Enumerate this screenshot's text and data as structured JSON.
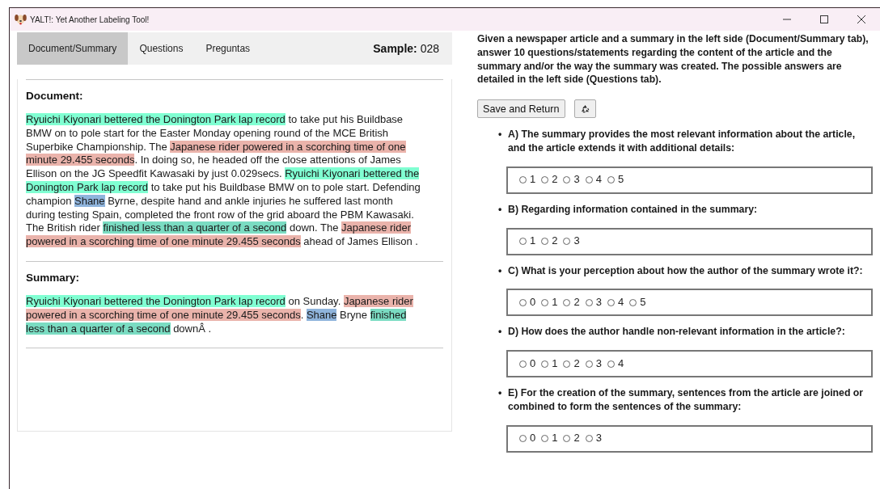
{
  "window": {
    "title": "YALT!: Yet Another Labeling Tool!"
  },
  "tabs": [
    {
      "label": "Document/Summary",
      "selected": true
    },
    {
      "label": "Questions",
      "selected": false
    },
    {
      "label": "Preguntas",
      "selected": false
    }
  ],
  "sample": {
    "label": "Sample:",
    "value": "028"
  },
  "document": {
    "heading": "Document:",
    "segments": [
      {
        "text": "Ryuichi Kiyonari bettered the Donington Park lap record",
        "color": "#80ffd2"
      },
      {
        "text": " to take put his Buildbase BMW on to pole start for the Easter Monday opening round of the MCE British Superbike Championship. The "
      },
      {
        "text": "Japanese rider powered in a scorching time of one minute 29.455 seconds",
        "color": "#eab3ab"
      },
      {
        "text": ". In doing so, he headed off the close attentions of James Ellison on the JG Speedfit Kawasaki by just 0.029secs. "
      },
      {
        "text": "Ryuichi Kiyonari bettered the Donington Park lap record",
        "color": "#80ffd2"
      },
      {
        "text": " to take put his Buildbase BMW on to pole start. Defending champion "
      },
      {
        "text": "Shane",
        "color": "#8fb4dc"
      },
      {
        "text": " Byrne, despite hand and ankle injuries he suffered last month during testing Spain, completed the front row of the grid aboard the PBM Kawasaki. The British rider "
      },
      {
        "text": "finished less than a quarter of a second",
        "color": "#7adcc2"
      },
      {
        "text": " down. The "
      },
      {
        "text": "Japanese rider powered in a scorching time of one minute 29.455 seconds",
        "color": "#eab3ab"
      },
      {
        "text": " ahead of James Ellison ."
      }
    ]
  },
  "summary": {
    "heading": "Summary:",
    "segments": [
      {
        "text": "Ryuichi Kiyonari bettered the Donington Park lap record",
        "color": "#80ffd2"
      },
      {
        "text": " on Sunday. "
      },
      {
        "text": "Japanese rider powered in a scorching time of one minute 29.455 seconds",
        "color": "#eab3ab"
      },
      {
        "text": ". "
      },
      {
        "text": "Shane",
        "color": "#8fb4dc"
      },
      {
        "text": " Bryne "
      },
      {
        "text": "finished less than a quarter of a second",
        "color": "#7adcc2"
      },
      {
        "text": " downÂ ."
      }
    ]
  },
  "instructions": "Given a newspaper article and a summary in the left side (Document/Summary tab), answer 10 questions/statements regarding the content of the article and the summary and/or the way the summary was created. The possible answers are detailed in the left side (Questions tab).",
  "buttons": {
    "save": "Save and Return"
  },
  "questions": [
    {
      "bullet": "•",
      "text": "A) The summary provides the most relevant information about the article, and the article extends it with additional details:",
      "options": [
        {
          "label": "1",
          "selected": false
        },
        {
          "label": "2",
          "selected": false
        },
        {
          "label": "3",
          "selected": false
        },
        {
          "label": "4",
          "selected": false
        },
        {
          "label": "5",
          "selected": false
        }
      ]
    },
    {
      "bullet": "•",
      "text": "B) Regarding information contained in the summary:",
      "options": [
        {
          "label": "1",
          "selected": false
        },
        {
          "label": "2",
          "selected": false
        },
        {
          "label": "3",
          "selected": false
        }
      ]
    },
    {
      "bullet": "•",
      "text": "C) What is your perception about how the author of the summary wrote it?:",
      "options": [
        {
          "label": "0",
          "selected": false
        },
        {
          "label": "1",
          "selected": false
        },
        {
          "label": "2",
          "selected": false
        },
        {
          "label": "3",
          "selected": false
        },
        {
          "label": "4",
          "selected": false
        },
        {
          "label": "5",
          "selected": false
        }
      ]
    },
    {
      "bullet": "•",
      "text": "D) How does the author handle non-relevant information in the article?:",
      "options": [
        {
          "label": "0",
          "selected": false
        },
        {
          "label": "1",
          "selected": false
        },
        {
          "label": "2",
          "selected": false
        },
        {
          "label": "3",
          "selected": false
        },
        {
          "label": "4",
          "selected": false
        }
      ]
    },
    {
      "bullet": "•",
      "text": "E) For the creation of the summary, sentences from the article are joined or combined to form the sentences of the summary:",
      "options": [
        {
          "label": "0",
          "selected": false
        },
        {
          "label": "1",
          "selected": false
        },
        {
          "label": "2",
          "selected": false
        },
        {
          "label": "3",
          "selected": false
        }
      ]
    }
  ]
}
